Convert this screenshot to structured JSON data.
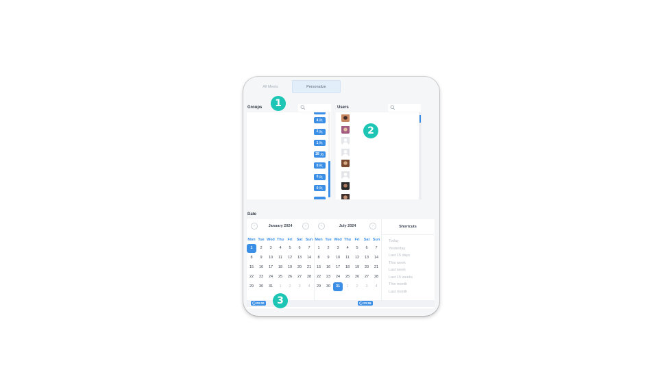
{
  "tabs": [
    {
      "label": "All Meets",
      "active": false
    },
    {
      "label": "Personalize",
      "active": true
    }
  ],
  "groups": {
    "title": "Groups",
    "badges": [
      "4",
      "2",
      "1",
      "28",
      "0",
      "0",
      "0"
    ]
  },
  "users": {
    "title": "Users",
    "avatars": [
      "photo",
      "photo",
      "placeholder",
      "placeholder",
      "photo",
      "placeholder",
      "photo",
      "photo"
    ]
  },
  "date": {
    "title": "Date",
    "weekdays": [
      "Mon",
      "Tue",
      "Wed",
      "Thu",
      "Fri",
      "Sat",
      "Sun"
    ],
    "calendars": [
      {
        "month": "January 2024",
        "rows": [
          [
            "1",
            "2",
            "3",
            "4",
            "5",
            "6",
            "7"
          ],
          [
            "8",
            "9",
            "10",
            "11",
            "12",
            "13",
            "14"
          ],
          [
            "15",
            "16",
            "17",
            "18",
            "19",
            "20",
            "21"
          ],
          [
            "22",
            "23",
            "24",
            "25",
            "26",
            "27",
            "28"
          ],
          [
            "29",
            "30",
            "31",
            "1",
            "2",
            "3",
            "4"
          ]
        ],
        "muted_from_row4_index": 3,
        "selected": "1"
      },
      {
        "month": "July 2024",
        "rows": [
          [
            "1",
            "2",
            "3",
            "4",
            "5",
            "6",
            "7"
          ],
          [
            "8",
            "9",
            "10",
            "11",
            "12",
            "13",
            "14"
          ],
          [
            "15",
            "16",
            "17",
            "18",
            "19",
            "20",
            "21"
          ],
          [
            "22",
            "23",
            "24",
            "25",
            "26",
            "27",
            "28"
          ],
          [
            "29",
            "30",
            "31",
            "1",
            "2",
            "3",
            "4"
          ]
        ],
        "muted_from_row4_index": 3,
        "selected": "31"
      }
    ],
    "shortcuts_title": "Shortcuts",
    "shortcuts": [
      "Today",
      "Yesterday",
      "Last 15 days",
      "This week",
      "Last week",
      "Last 15 weeks",
      "This month",
      "Last month"
    ],
    "start_time": "00:00",
    "end_time": "23:59"
  },
  "markers": [
    "1",
    "2",
    "3"
  ],
  "colors": {
    "accent": "#3a8ee6",
    "marker": "#1cc5b4"
  }
}
